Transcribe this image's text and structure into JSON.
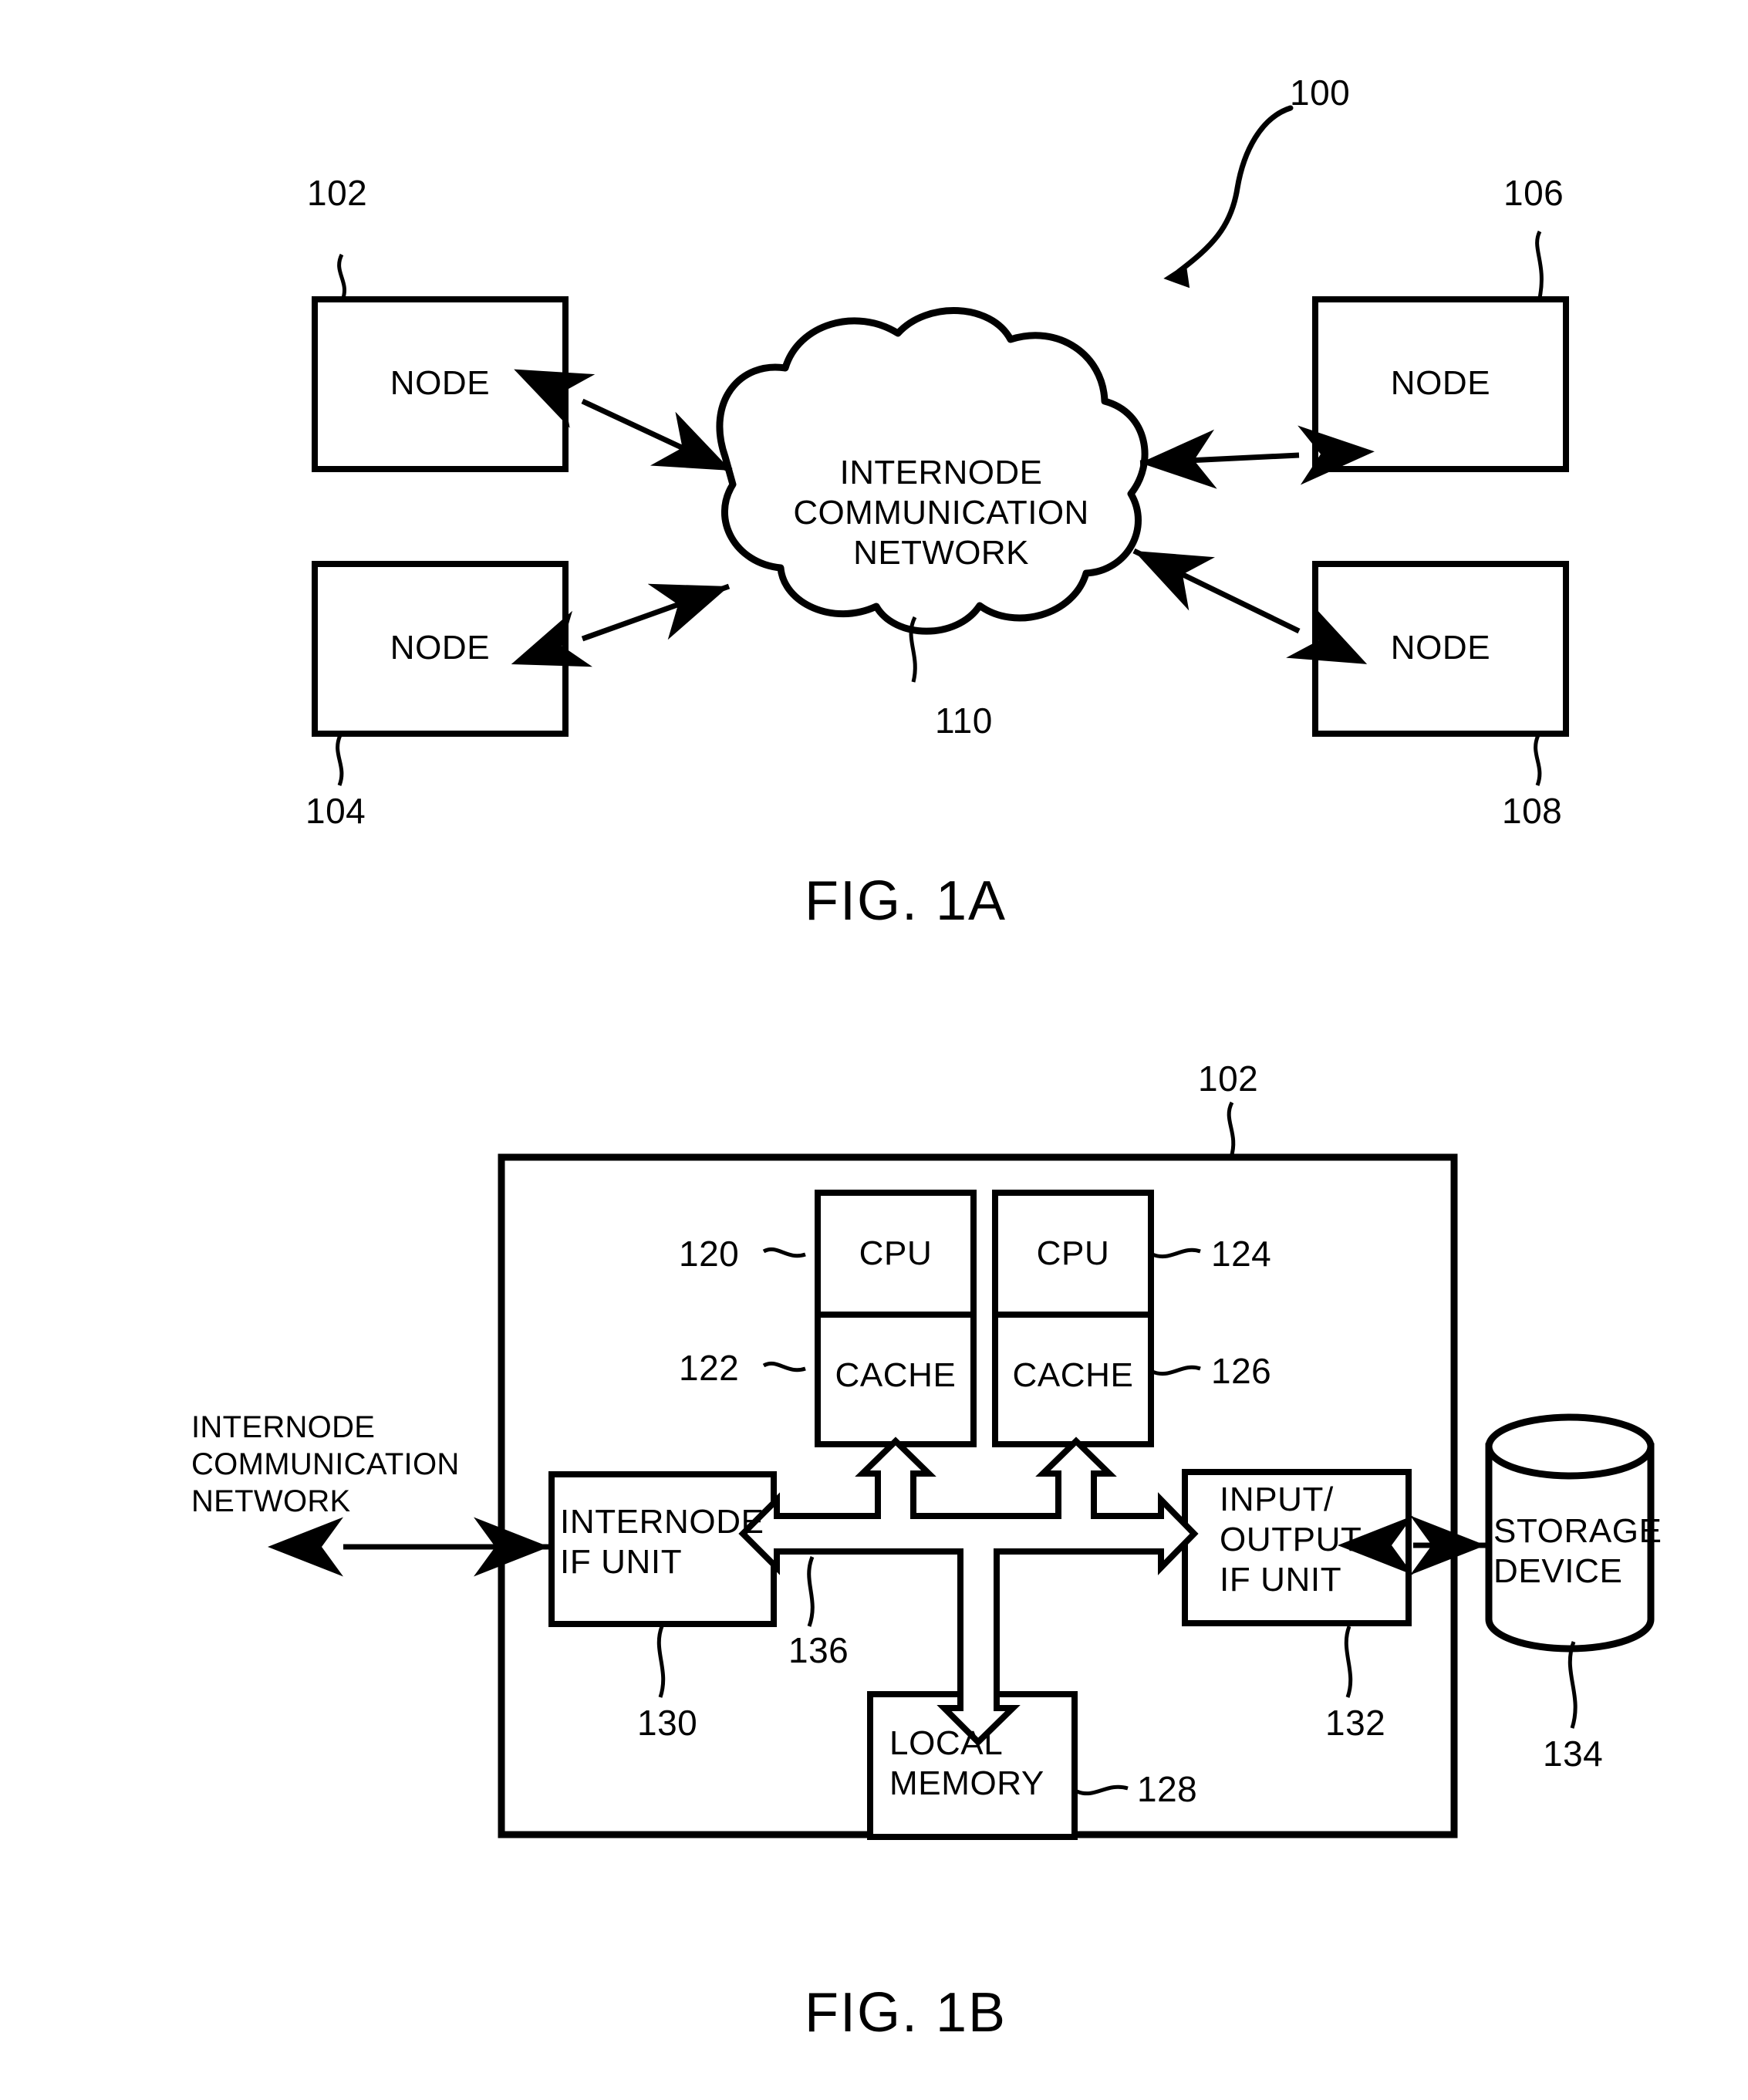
{
  "figures": [
    {
      "id": "fig-1a",
      "caption": "FIG. 1A",
      "system_ref": "100",
      "nodes": [
        {
          "label": "NODE",
          "ref": "102"
        },
        {
          "label": "NODE",
          "ref": "104"
        },
        {
          "label": "NODE",
          "ref": "106"
        },
        {
          "label": "NODE",
          "ref": "108"
        }
      ],
      "cloud": {
        "ref": "110",
        "line1": "INTERNODE",
        "line2": "COMMUNICATION",
        "line3": "NETWORK"
      }
    },
    {
      "id": "fig-1b",
      "caption": "FIG. 1B",
      "node_ref": "102",
      "external_network_label": {
        "line1": "INTERNODE",
        "line2": "COMMUNICATION",
        "line3": "NETWORK"
      },
      "blocks": [
        {
          "name": "cpu-0",
          "label": "CPU",
          "ref": "120",
          "ref_side": "left"
        },
        {
          "name": "cache-0",
          "label": "CACHE",
          "ref": "122",
          "ref_side": "left"
        },
        {
          "name": "cpu-1",
          "label": "CPU",
          "ref": "124",
          "ref_side": "right"
        },
        {
          "name": "cache-1",
          "label": "CACHE",
          "ref": "126",
          "ref_side": "right"
        },
        {
          "name": "internode-if-unit",
          "label_line1": "INTERNODE",
          "label_line2": "IF UNIT",
          "ref": "130",
          "ref_side": "below"
        },
        {
          "name": "io-if-unit",
          "label_line1": "INPUT/",
          "label_line2": "OUTPUT",
          "label_line3": "IF UNIT",
          "ref": "132",
          "ref_side": "below"
        },
        {
          "name": "local-memory",
          "label_line1": "LOCAL",
          "label_line2": "MEMORY",
          "ref": "128",
          "ref_side": "right"
        },
        {
          "name": "storage-device",
          "label_line1": "STORAGE",
          "label_line2": "DEVICE",
          "ref": "134",
          "ref_side": "below"
        }
      ],
      "bus": {
        "name": "internal-bus",
        "ref": "136"
      }
    }
  ],
  "colors": {
    "ink": "#000000",
    "paper": "#ffffff"
  }
}
